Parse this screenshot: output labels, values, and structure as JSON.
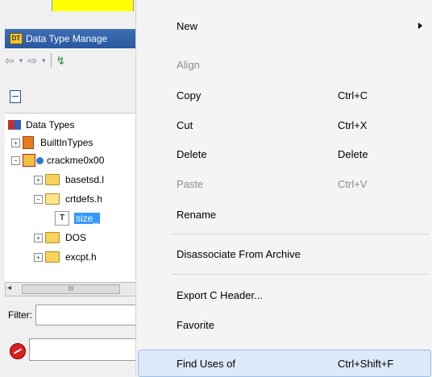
{
  "left_panel": {
    "title": "Data Type Manage",
    "title_icon_text": "DT",
    "toolbar": {
      "back": "⇦",
      "back_dd": "▾",
      "fwd": "⇨",
      "fwd_dd": "▾",
      "network": "↯"
    },
    "tree": {
      "root": "Data Types",
      "builtin": "BuiltInTypes",
      "archive": "crackme0x00",
      "basetsd": "basetsd.l",
      "crtdefs": "crtdefs.h",
      "size": "size_",
      "dos": "DOS",
      "excpt": "excpt.h"
    },
    "hscroll": {
      "left_arrow": "◂",
      "thumb": "III"
    },
    "filter_label": "Filter:"
  },
  "menu": {
    "items": [
      {
        "label": "New",
        "shortcut": "",
        "enabled": true,
        "submenu": true
      },
      {
        "label": "Align",
        "shortcut": "",
        "enabled": false
      },
      {
        "label": "Copy",
        "shortcut": "Ctrl+C",
        "enabled": true
      },
      {
        "label": "Cut",
        "shortcut": "Ctrl+X",
        "enabled": true
      },
      {
        "label": "Delete",
        "shortcut": "Delete",
        "enabled": true
      },
      {
        "label": "Paste",
        "shortcut": "Ctrl+V",
        "enabled": false
      },
      {
        "label": "Rename",
        "shortcut": "",
        "enabled": true
      },
      {
        "label": "Disassociate From Archive",
        "shortcut": "",
        "enabled": true
      },
      {
        "label": "Export C Header...",
        "shortcut": "",
        "enabled": true
      },
      {
        "label": "Favorite",
        "shortcut": "",
        "enabled": true
      },
      {
        "label": "Find Uses of",
        "shortcut": "Ctrl+Shift+F",
        "enabled": true,
        "hovered": true
      }
    ]
  },
  "colors": {
    "selection": "#3399ff",
    "title_bar": "#2a58a0",
    "menu_hover": "#dce9f8",
    "disabled_text": "#8c8c8c"
  }
}
